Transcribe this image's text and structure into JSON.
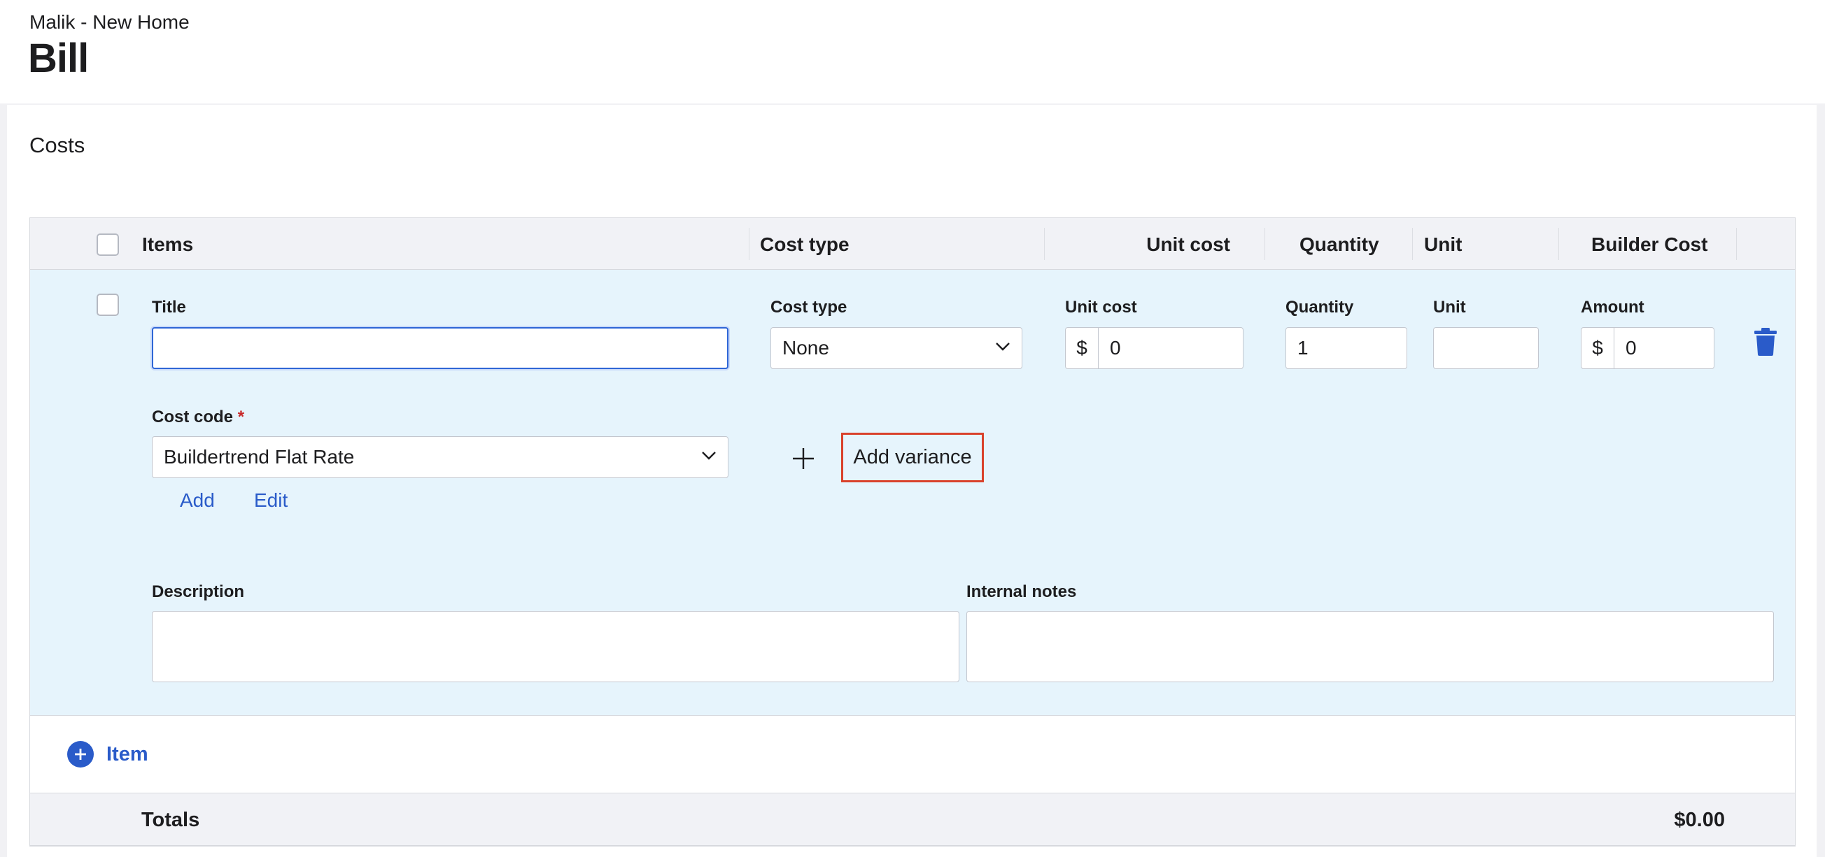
{
  "header": {
    "project": "Malik - New Home",
    "title": "Bill"
  },
  "costs": {
    "section_title": "Costs",
    "columns": [
      "Items",
      "Cost type",
      "Unit cost",
      "Quantity",
      "Unit",
      "Builder Cost"
    ],
    "row": {
      "title_label": "Title",
      "title_value": "",
      "cost_type_label": "Cost type",
      "cost_type_value": "None",
      "unit_cost_label": "Unit cost",
      "unit_cost_prefix": "$",
      "unit_cost_value": "0",
      "quantity_label": "Quantity",
      "quantity_value": "1",
      "unit_label": "Unit",
      "unit_value": "",
      "amount_label": "Amount",
      "amount_prefix": "$",
      "amount_value": "0",
      "cost_code_label": "Cost code",
      "required_mark": "*",
      "cost_code_value": "Buildertrend Flat Rate",
      "add_link": "Add",
      "edit_link": "Edit",
      "add_variance": "Add variance",
      "description_label": "Description",
      "internal_notes_label": "Internal notes"
    },
    "add_item_label": "Item",
    "totals_label": "Totals",
    "totals_value": "$0.00"
  },
  "colors": {
    "accent": "#2a5bc9",
    "row_highlight": "#e6f4fc",
    "variance_outline": "#d9412b"
  },
  "icons": {
    "delete": "trash-icon",
    "add": "plus-icon",
    "dropdown": "chevron-down-icon"
  }
}
